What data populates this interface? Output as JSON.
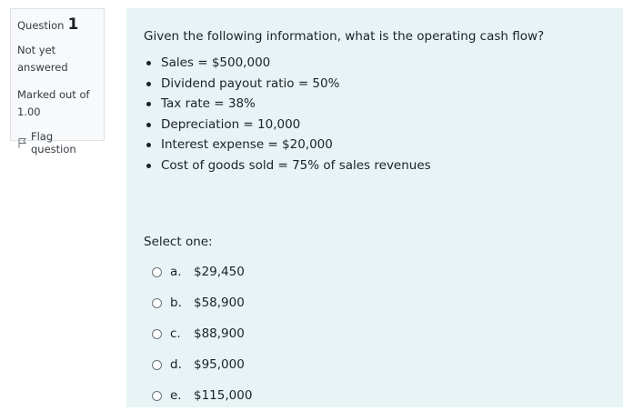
{
  "info": {
    "question_label": "Question",
    "question_number": "1",
    "state_line1": "Not yet",
    "state_line2": "answered",
    "grade_line1": "Marked out of",
    "grade_line2": "1.00",
    "flag_label": "Flag question",
    "flag_icon": "flag-outline-icon"
  },
  "question": {
    "text": "Given the following information, what is the operating cash flow?",
    "given": [
      "Sales = $500,000",
      "Dividend payout ratio = 50%",
      "Tax rate = 38%",
      "Depreciation = 10,000",
      "Interest expense = $20,000",
      "Cost of goods sold = 75% of sales revenues"
    ],
    "prompt": "Select one:",
    "answers": [
      {
        "letter": "a.",
        "value": "$29,450"
      },
      {
        "letter": "b.",
        "value": "$58,900"
      },
      {
        "letter": "c.",
        "value": "$88,900"
      },
      {
        "letter": "d.",
        "value": "$95,000"
      },
      {
        "letter": "e.",
        "value": "$115,000"
      }
    ]
  },
  "colors": {
    "content_background": "#e7f3f5",
    "info_background": "#f8f9fa",
    "text": "#1d2125"
  }
}
